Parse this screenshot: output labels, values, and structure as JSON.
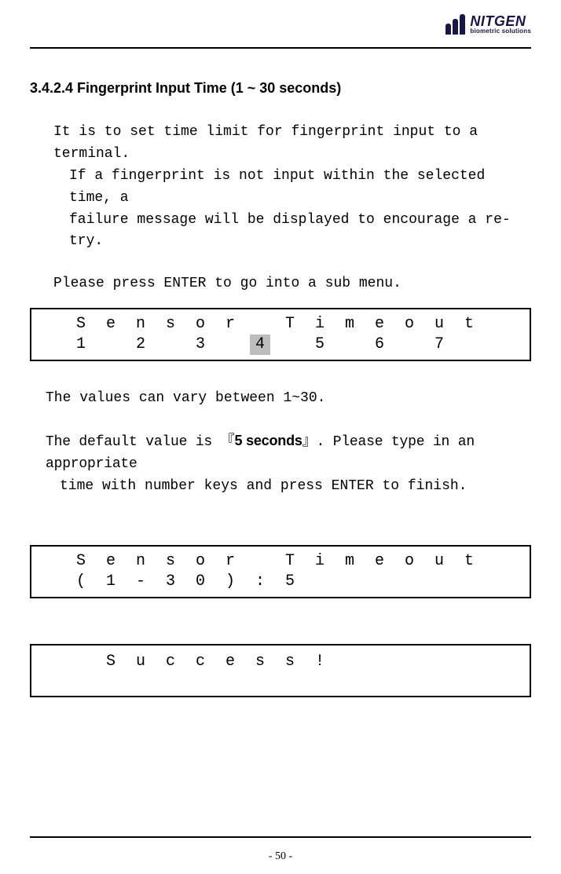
{
  "logo": {
    "main": "NITGEN",
    "sub": "biometric solutions"
  },
  "section_title": "3.4.2.4 Fingerprint Input Time (1 ~ 30 seconds)",
  "para1_l1": "It is to set time limit for fingerprint input to a terminal.",
  "para1_l2": "If a fingerprint is not input within the selected time, a",
  "para1_l3": "failure message will be displayed to encourage a re-try.",
  "para2": "Please press ENTER to go into a sub menu.",
  "lcd1": {
    "row1": [
      "",
      "S",
      "e",
      "n",
      "s",
      "o",
      "r",
      "",
      "T",
      "i",
      "m",
      "e",
      "o",
      "u",
      "t"
    ],
    "row2": [
      "",
      "1",
      "",
      "2",
      "",
      "3",
      "",
      "4",
      "",
      "5",
      "",
      "6",
      "",
      "7",
      ""
    ],
    "selected_index": 7
  },
  "para3": "The values can vary between 1~30.",
  "para4_pre": "The default value is ",
  "para4_q1": "『",
  "para4_bold": "5 seconds",
  "para4_q2": "』",
  "para4_post": ". Please type in an appropriate",
  "para4_l2": "time with number keys and press ENTER to finish.",
  "lcd2": {
    "row1": [
      "",
      "S",
      "e",
      "n",
      "s",
      "o",
      "r",
      "",
      "T",
      "i",
      "m",
      "e",
      "o",
      "u",
      "t"
    ],
    "row2": [
      "",
      "(",
      "1",
      "-",
      "3",
      "0",
      ")",
      ":",
      "5",
      "",
      "",
      "",
      "",
      "",
      ""
    ]
  },
  "lcd3": {
    "row1": [
      "",
      "",
      "S",
      "u",
      "c",
      "c",
      "e",
      "s",
      "s",
      "!",
      "",
      "",
      "",
      "",
      ""
    ]
  },
  "page_number": "- 50 -"
}
